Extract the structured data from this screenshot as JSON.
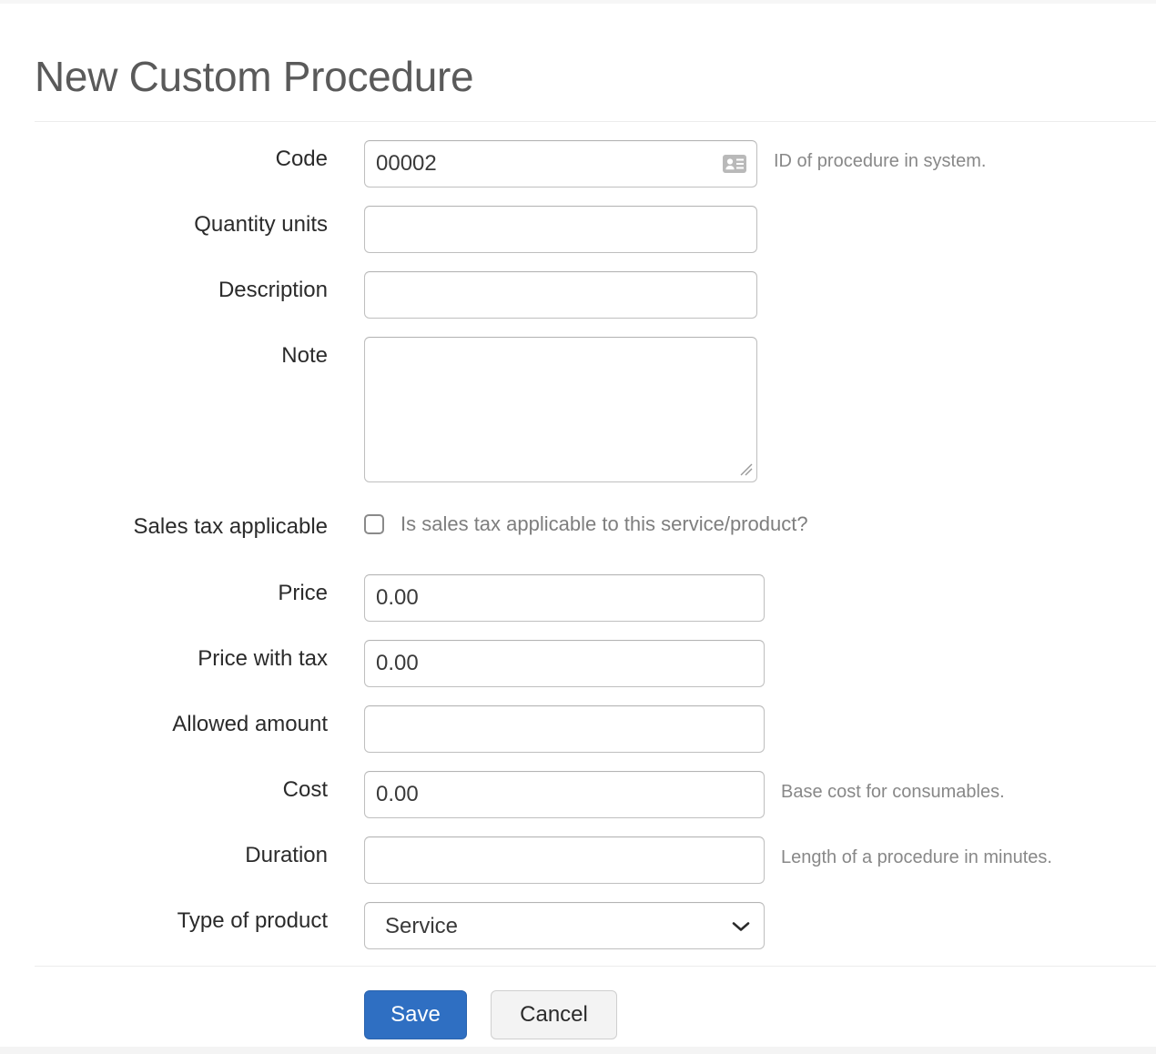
{
  "page": {
    "title": "New Custom Procedure"
  },
  "form": {
    "rows": [
      {
        "label": "Code",
        "type": "text",
        "value": "00002",
        "placeholder": "",
        "help": "ID of procedure in system.",
        "icon": "id-card-icon"
      },
      {
        "label": "Quantity units",
        "type": "text",
        "value": "",
        "placeholder": "",
        "help": ""
      },
      {
        "label": "Description",
        "type": "text",
        "value": "",
        "placeholder": "",
        "help": ""
      },
      {
        "label": "Note",
        "type": "textarea",
        "value": "",
        "placeholder": "",
        "help": ""
      },
      {
        "label": "Sales tax applicable",
        "type": "checkbox",
        "checked": false,
        "checkbox_text": "Is sales tax applicable to this service/product?",
        "help": ""
      },
      {
        "label": "Price",
        "type": "text",
        "value": "0.00",
        "placeholder": "",
        "help": ""
      },
      {
        "label": "Price with tax",
        "type": "text",
        "value": "0.00",
        "placeholder": "",
        "help": ""
      },
      {
        "label": "Allowed amount",
        "type": "text",
        "value": "",
        "placeholder": "",
        "help": ""
      },
      {
        "label": "Cost",
        "type": "text",
        "value": "0.00",
        "placeholder": "",
        "help": "Base cost for consumables."
      },
      {
        "label": "Duration",
        "type": "text",
        "value": "",
        "placeholder": "",
        "help": "Length of a procedure in minutes."
      },
      {
        "label": "Type of product",
        "type": "select",
        "value": "Service",
        "options": [
          "Service"
        ],
        "help": "",
        "icon": "chevron-down-icon"
      }
    ]
  },
  "actions": {
    "save_label": "Save",
    "cancel_label": "Cancel"
  },
  "colors": {
    "primary": "#2f6fc2",
    "label_text": "#2b2b2b",
    "help_text": "#888888",
    "title_text": "#5a5a5a",
    "border": "#bfbfbf",
    "divider": "#ececec"
  }
}
